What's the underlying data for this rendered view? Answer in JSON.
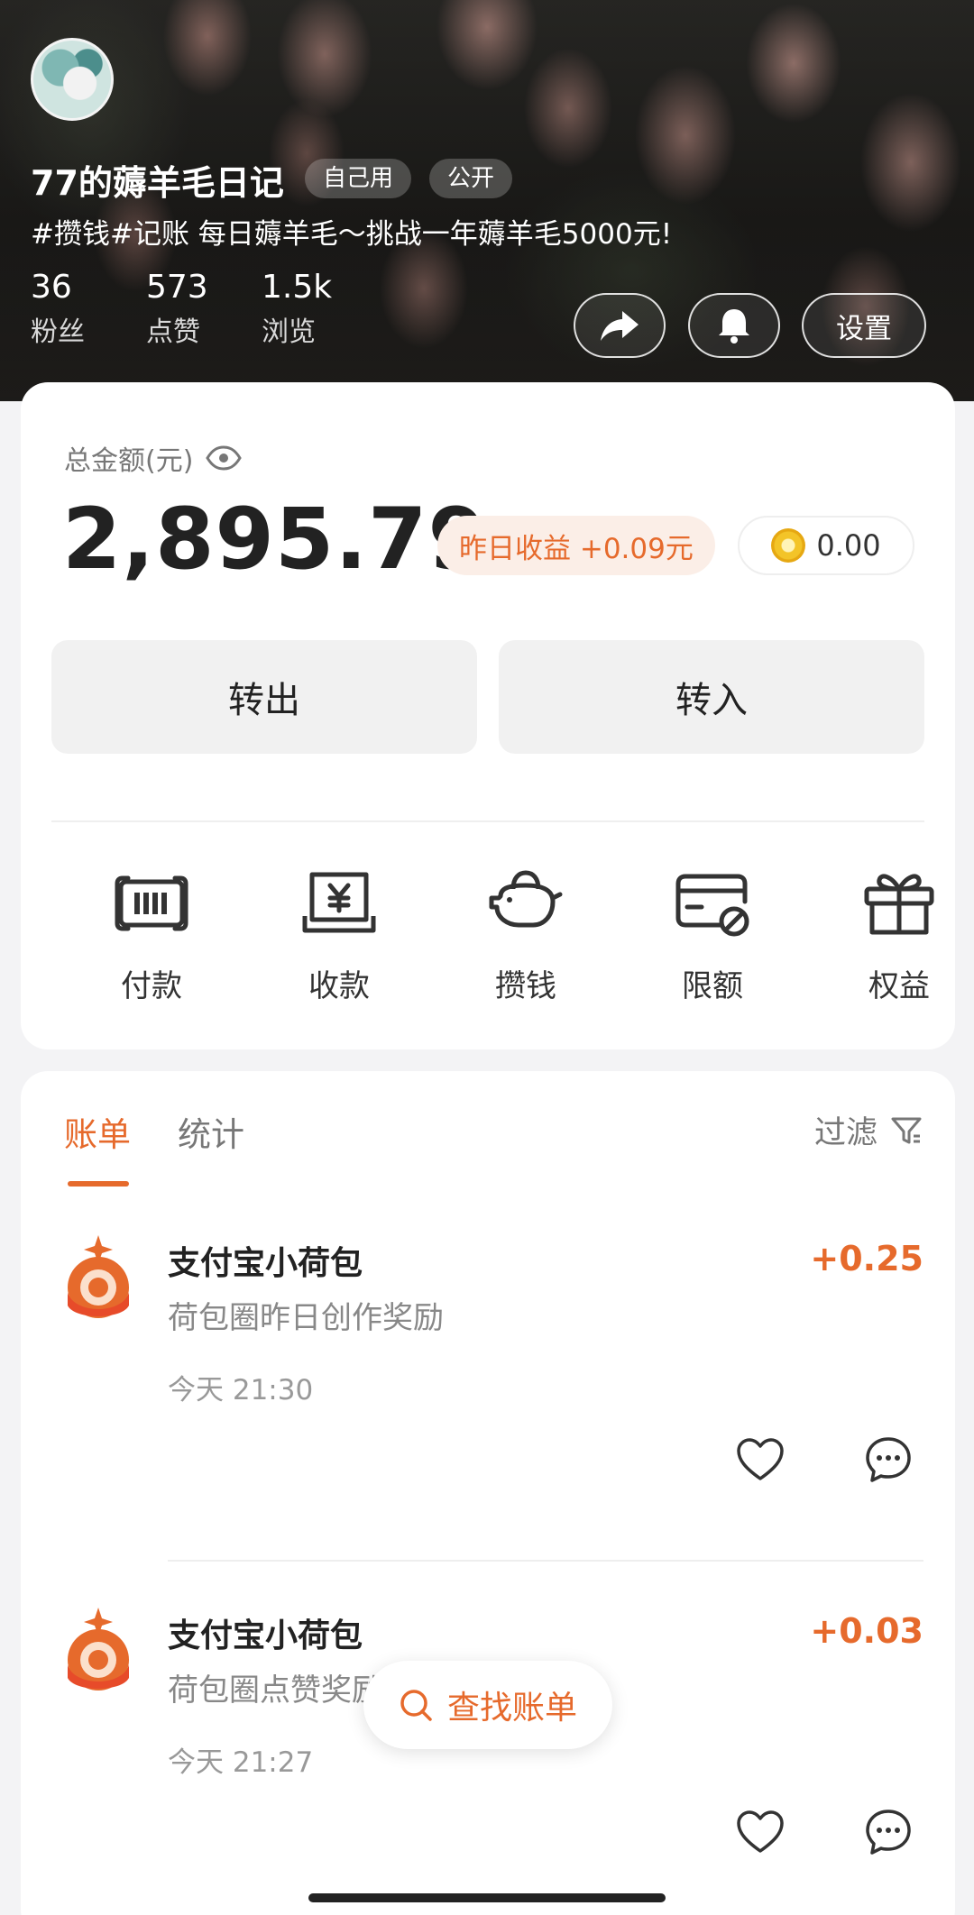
{
  "profile": {
    "name": "77的薅羊毛日记",
    "tags": [
      "自己用",
      "公开"
    ],
    "description": "#攒钱#记账  每日薅羊毛～挑战一年薅羊毛5000元!",
    "stats": [
      {
        "value": "36",
        "label": "粉丝"
      },
      {
        "value": "573",
        "label": "点赞"
      },
      {
        "value": "1.5k",
        "label": "浏览"
      }
    ],
    "settings_label": "设置"
  },
  "balance": {
    "label": "总金额(元)",
    "amount": "2,895.79",
    "yesterday": "昨日收益 +0.09元",
    "coin_value": "0.00",
    "transfer_out": "转出",
    "transfer_in": "转入"
  },
  "quick_actions": [
    {
      "label": "付款",
      "icon": "payment-icon"
    },
    {
      "label": "收款",
      "icon": "receive-icon"
    },
    {
      "label": "攒钱",
      "icon": "piggy-bank-icon"
    },
    {
      "label": "限额",
      "icon": "card-limit-icon"
    },
    {
      "label": "权益",
      "icon": "gift-icon"
    }
  ],
  "bills": {
    "tabs": [
      "账单",
      "统计"
    ],
    "filter_label": "过滤",
    "items": [
      {
        "title": "支付宝小荷包",
        "desc": "荷包圈昨日创作奖励",
        "time": "今天 21:30",
        "amount": "+0.25"
      },
      {
        "title": "支付宝小荷包",
        "desc": "荷包圈点赞奖励",
        "time": "今天 21:27",
        "amount": "+0.03"
      }
    ],
    "search_label": "查找账单"
  },
  "colors": {
    "accent": "#e66a2c",
    "accent_bg": "#fbeee7",
    "page_bg": "#f3f3f5"
  }
}
